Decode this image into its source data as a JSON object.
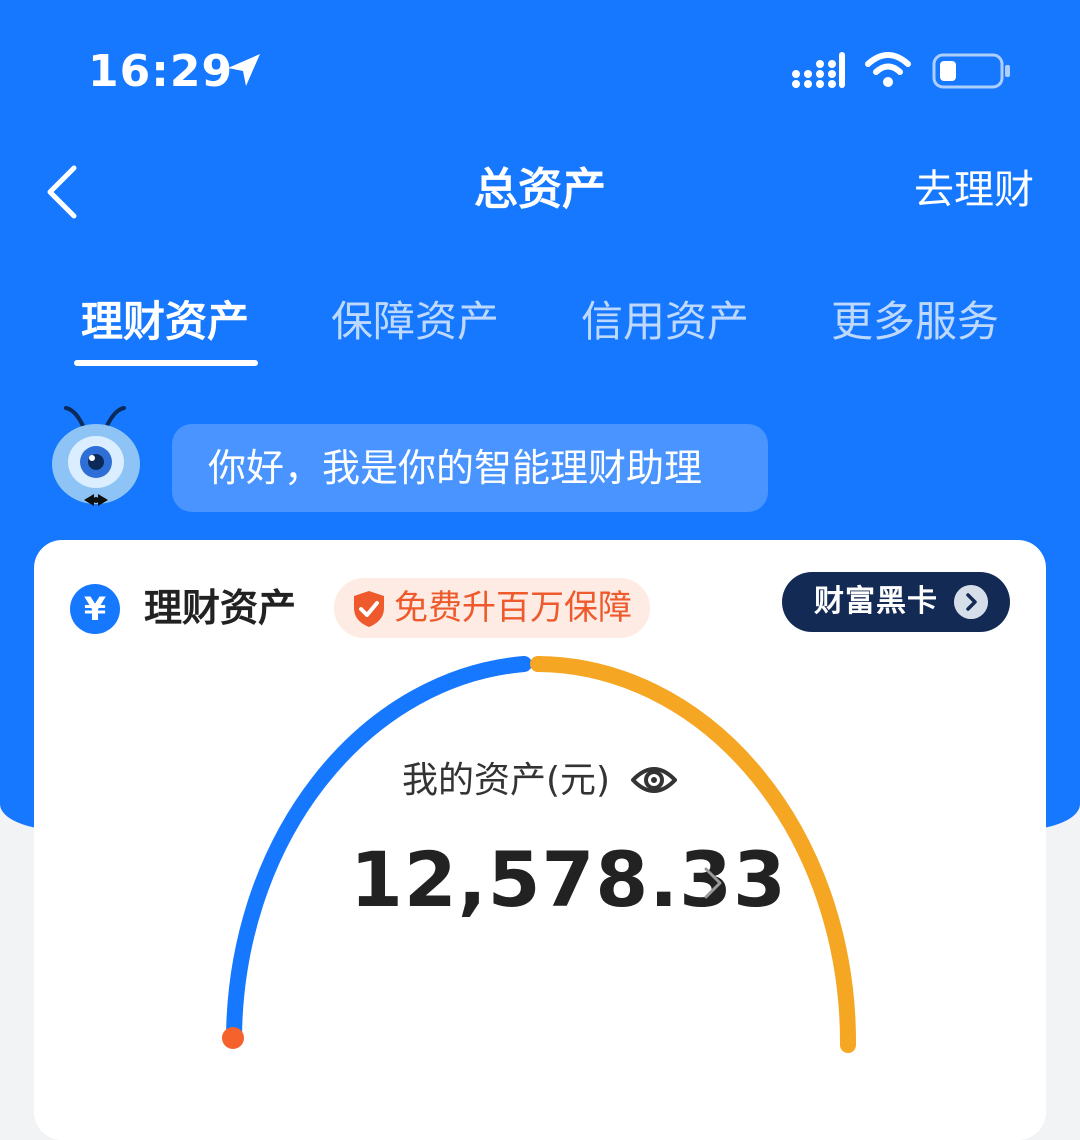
{
  "status_bar": {
    "time": "16:29"
  },
  "nav": {
    "title": "总资产",
    "right_action": "去理财"
  },
  "tabs": [
    {
      "label": "理财资产",
      "active": true
    },
    {
      "label": "保障资产",
      "active": false
    },
    {
      "label": "信用资产",
      "active": false
    },
    {
      "label": "更多服务",
      "active": false
    }
  ],
  "assistant": {
    "message": "你好，我是你的智能理财助理"
  },
  "card": {
    "icon_symbol": "¥",
    "title": "理财资产",
    "promo_label": "免费升百万保障",
    "black_card_label": "财富黑卡"
  },
  "assets": {
    "label": "我的资产(元)",
    "value": "12,578.33",
    "gauge_colors": {
      "segment_1": "#1677ff",
      "segment_2": "#f5a623",
      "start_dot": "#f5622c"
    }
  },
  "colors": {
    "brand_blue": "#1677ff",
    "promo_orange": "#ee5a2c",
    "black_card_navy": "#132a55"
  }
}
